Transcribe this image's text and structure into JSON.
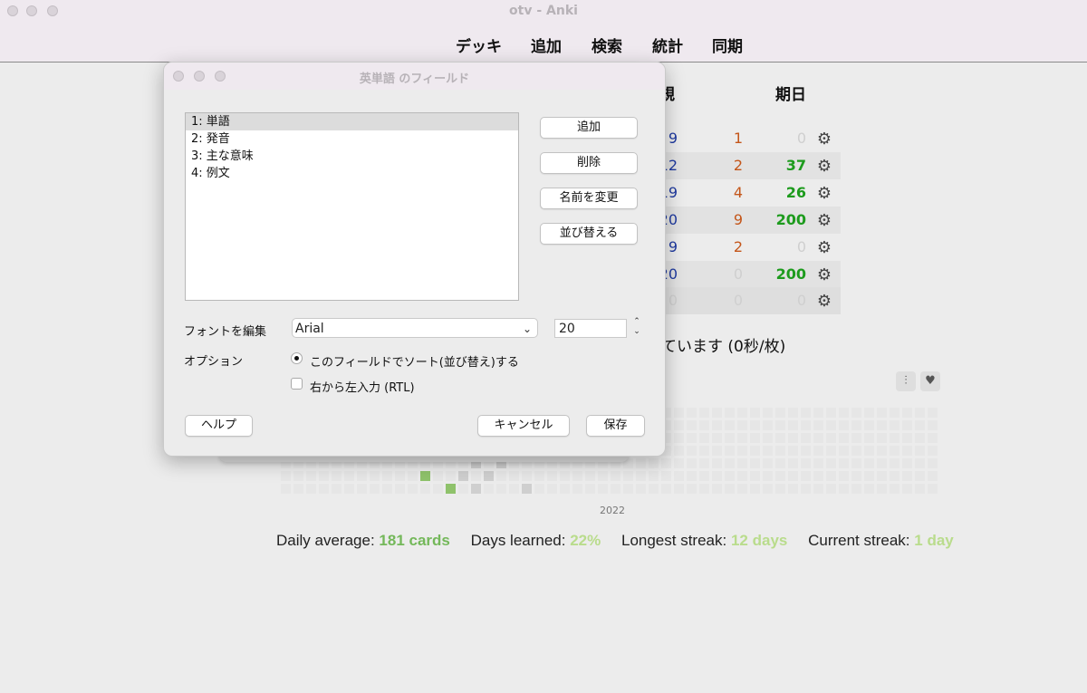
{
  "window": {
    "title": "otv - Anki"
  },
  "toolbar": {
    "items": [
      "デッキ",
      "追加",
      "検索",
      "統計",
      "同期"
    ]
  },
  "deck_table": {
    "headers": [
      "規",
      "期日"
    ],
    "rows": [
      {
        "new": "9",
        "learn": "1",
        "due": "0"
      },
      {
        "new": "12",
        "learn": "2",
        "due": "37"
      },
      {
        "new": "19",
        "learn": "4",
        "due": "26"
      },
      {
        "new": "20",
        "learn": "9",
        "due": "200"
      },
      {
        "new": "9",
        "learn": "2",
        "due": "0"
      },
      {
        "new": "20",
        "learn": "0",
        "due": "200"
      },
      {
        "new": "0",
        "learn": "0",
        "due": "0"
      }
    ]
  },
  "study_text": "ています (0秒/枚)",
  "heatmap": {
    "year": "2022"
  },
  "stats": {
    "daily_average_label": "Daily average:",
    "daily_average_value": "181 cards",
    "days_learned_label": "Days learned:",
    "days_learned_value": "22%",
    "longest_streak_label": "Longest streak:",
    "longest_streak_value": "12 days",
    "current_streak_label": "Current streak:",
    "current_streak_value": "1 day"
  },
  "dialog": {
    "title": "英単語 のフィールド",
    "fields": [
      "1: 単語",
      "2: 発音",
      "3: 主な意味",
      "4: 例文"
    ],
    "buttons": {
      "add": "追加",
      "delete": "削除",
      "rename": "名前を変更",
      "reorder": "並び替える"
    },
    "font_label": "フォントを編集",
    "font_value": "Arial",
    "font_size": "20",
    "options_label": "オプション",
    "sort_option": "このフィールドでソート(並び替え)する",
    "rtl_option": "右から左入力 (RTL)",
    "help": "ヘルプ",
    "cancel": "キャンセル",
    "save": "保存"
  }
}
